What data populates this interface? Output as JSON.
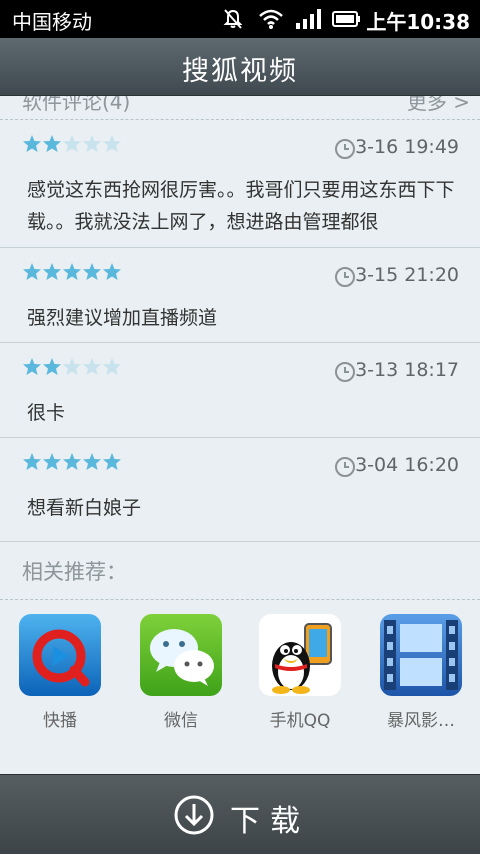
{
  "status_bar": {
    "carrier": "中国移动",
    "time": "上午10:38"
  },
  "title_bar": {
    "title": "搜狐视频"
  },
  "reviews_section": {
    "label": "软件评论(4)",
    "more_label": "更多 >",
    "reviews": [
      {
        "rating": 2,
        "date": "3-16 19:49",
        "text": "感觉这东西抢网很厉害。。我哥们只要用这东西下下载。。我就没法上网了，想进路由管理都很"
      },
      {
        "rating": 5,
        "date": "3-15 21:20",
        "text": "强烈建议增加直播频道"
      },
      {
        "rating": 2,
        "date": "3-13 18:17",
        "text": "很卡"
      },
      {
        "rating": 5,
        "date": "3-04 16:20",
        "text": "想看新白娘子"
      }
    ]
  },
  "recommend": {
    "label": "相关推荐：",
    "apps": [
      {
        "name": "快播",
        "icon": "qvod-icon"
      },
      {
        "name": "微信",
        "icon": "wechat-icon"
      },
      {
        "name": "手机QQ",
        "icon": "qq-icon"
      },
      {
        "name": "暴风影…",
        "icon": "baofeng-icon"
      }
    ]
  },
  "bottom_bar": {
    "download_label": "下载"
  },
  "colors": {
    "star_filled": "#5ab8dc",
    "star_empty": "#c9e3ee",
    "title_bar": "#4a555b",
    "bottom_bar": "#474f53"
  }
}
